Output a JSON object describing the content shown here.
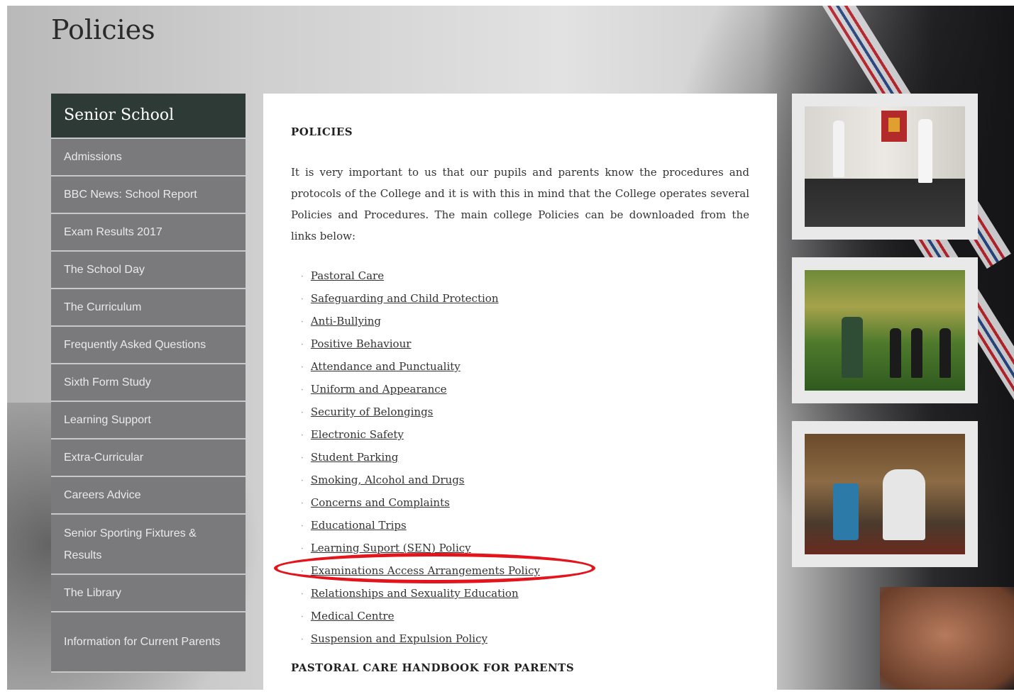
{
  "page": {
    "title": "Policies"
  },
  "sidebar": {
    "header": "Senior School",
    "items": [
      {
        "label": "Admissions"
      },
      {
        "label": "BBC News: School Report"
      },
      {
        "label": "Exam Results 2017"
      },
      {
        "label": "The School Day"
      },
      {
        "label": "The Curriculum"
      },
      {
        "label": "Frequently Asked Questions"
      },
      {
        "label": "Sixth Form Study"
      },
      {
        "label": "Learning Support"
      },
      {
        "label": "Extra-Curricular"
      },
      {
        "label": "Careers Advice"
      },
      {
        "label": "Senior Sporting Fixtures & Results"
      },
      {
        "label": "The Library"
      },
      {
        "label": "Information for Current Parents"
      }
    ]
  },
  "content": {
    "heading": "POLICIES",
    "intro": "It is very important to us that our pupils and parents know the procedures and protocols of the College and it is with this in mind that the College operates several Policies and Procedures. The main college Policies can be downloaded from the links below:",
    "bullet": "·",
    "policies": [
      {
        "label": "Pastoral Care"
      },
      {
        "label": "Safeguarding and Child Protection"
      },
      {
        "label": "Anti-Bullying"
      },
      {
        "label": "Positive Behaviour"
      },
      {
        "label": "Attendance and Punctuality"
      },
      {
        "label": "Uniform and Appearance"
      },
      {
        "label": "Security of Belongings"
      },
      {
        "label": "Electronic Safety"
      },
      {
        "label": "Student Parking"
      },
      {
        "label": "Smoking, Alcohol and Drugs"
      },
      {
        "label": "Concerns and Complaints"
      },
      {
        "label": "Educational Trips"
      },
      {
        "label": "Learning Suport (SEN) Policy"
      },
      {
        "label": "Examinations Access Arrangements Policy"
      },
      {
        "label": "Relationships and Sexuality Education"
      },
      {
        "label": "Medical Centre"
      },
      {
        "label": "Suspension and Expulsion Policy"
      }
    ],
    "subheading": "PASTORAL CARE HANDBOOK FOR PARENTS"
  },
  "annotation": {
    "highlight_color": "#e3141c",
    "highlighted_item": "Examinations Access Arrangements Policy"
  },
  "colors": {
    "sidebar_header_bg": "#2e3a35",
    "sidebar_item_bg": "#7a7a7c"
  }
}
